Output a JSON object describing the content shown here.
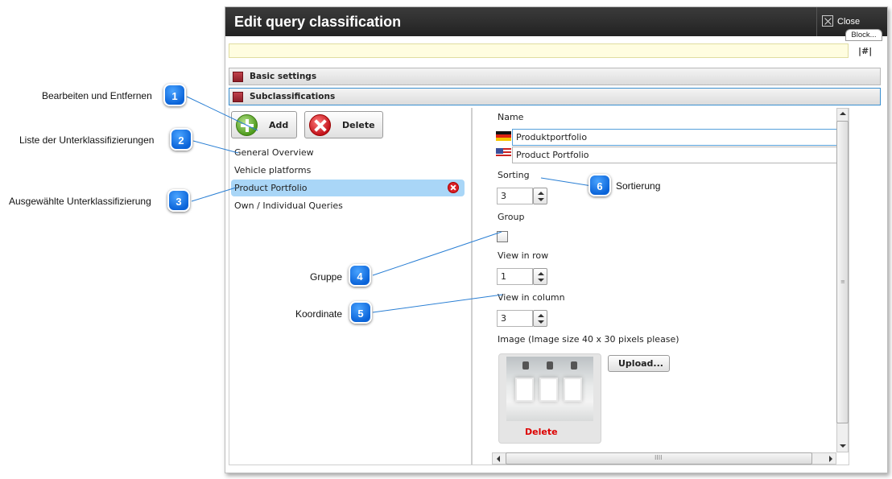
{
  "dialog": {
    "title": "Edit query classification",
    "close_label": "Close",
    "block_badge": "Block...",
    "hash_link": "|#|"
  },
  "accordion": {
    "basic_settings": "Basic settings",
    "subclassifications": "Subclassifications"
  },
  "toolbar": {
    "add_label": "Add",
    "delete_label": "Delete"
  },
  "subclass_list": [
    "General Overview",
    "Vehicle platforms",
    "Product Portfolio",
    "Own / Individual Queries"
  ],
  "form": {
    "name_label": "Name",
    "name_de": "Produktportfolio",
    "name_en": "Product Portfolio",
    "sorting_label": "Sorting",
    "sorting_value": "3",
    "group_label": "Group",
    "view_row_label": "View in row",
    "view_row_value": "1",
    "view_col_label": "View in column",
    "view_col_value": "3",
    "image_label": "Image (Image size 40 x 30 pixels please)",
    "upload_label": "Upload...",
    "image_delete_label": "Delete"
  },
  "callouts": [
    {
      "num": "1",
      "text": "Bearbeiten und Entfernen"
    },
    {
      "num": "2",
      "text": "Liste der Unterklassifizierungen"
    },
    {
      "num": "3",
      "text": "Ausgewählte Unterklassifizierung"
    },
    {
      "num": "4",
      "text": "Gruppe"
    },
    {
      "num": "5",
      "text": "Koordinate"
    },
    {
      "num": "6",
      "text": "Sortierung"
    }
  ],
  "colors": {
    "titlebar": "#2b2b2b",
    "accent": "#3a8fd0",
    "selection": "#a9d6f7",
    "callout": "#0a63d8",
    "delete_red": "#dd0000"
  },
  "scrollbar_grip": "IIII"
}
